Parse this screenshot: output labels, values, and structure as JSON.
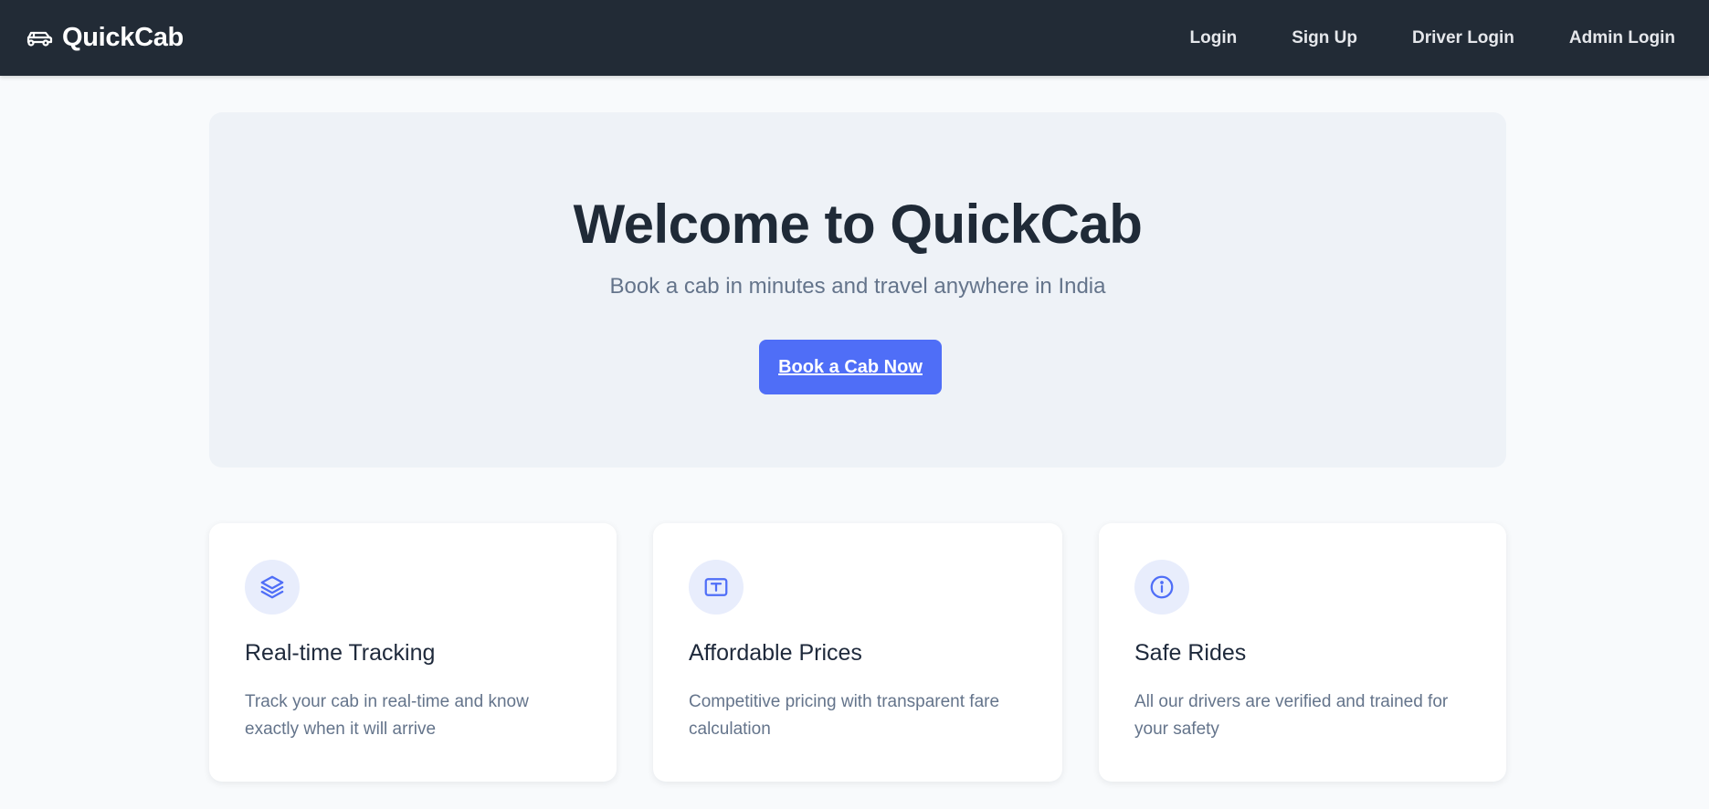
{
  "brand": {
    "name": "QuickCab",
    "icon": "car-icon"
  },
  "nav": {
    "links": [
      {
        "label": "Login"
      },
      {
        "label": "Sign Up"
      },
      {
        "label": "Driver Login"
      },
      {
        "label": "Admin Login"
      }
    ]
  },
  "hero": {
    "title": "Welcome to QuickCab",
    "subtitle": "Book a cab in minutes and travel anywhere in India",
    "cta_label": "Book a Cab Now"
  },
  "features": [
    {
      "icon": "layers-icon",
      "title": "Real-time Tracking",
      "description": "Track your cab in real-time and know exactly when it will arrive"
    },
    {
      "icon": "receipt-icon",
      "title": "Affordable Prices",
      "description": "Competitive pricing with transparent fare calculation"
    },
    {
      "icon": "info-icon",
      "title": "Safe Rides",
      "description": "All our drivers are verified and trained for your safety"
    }
  ],
  "colors": {
    "navbar": "#222b36",
    "accent": "#4f6ef7",
    "hero_bg": "#eef2f7",
    "page_bg": "#f8fafc"
  }
}
